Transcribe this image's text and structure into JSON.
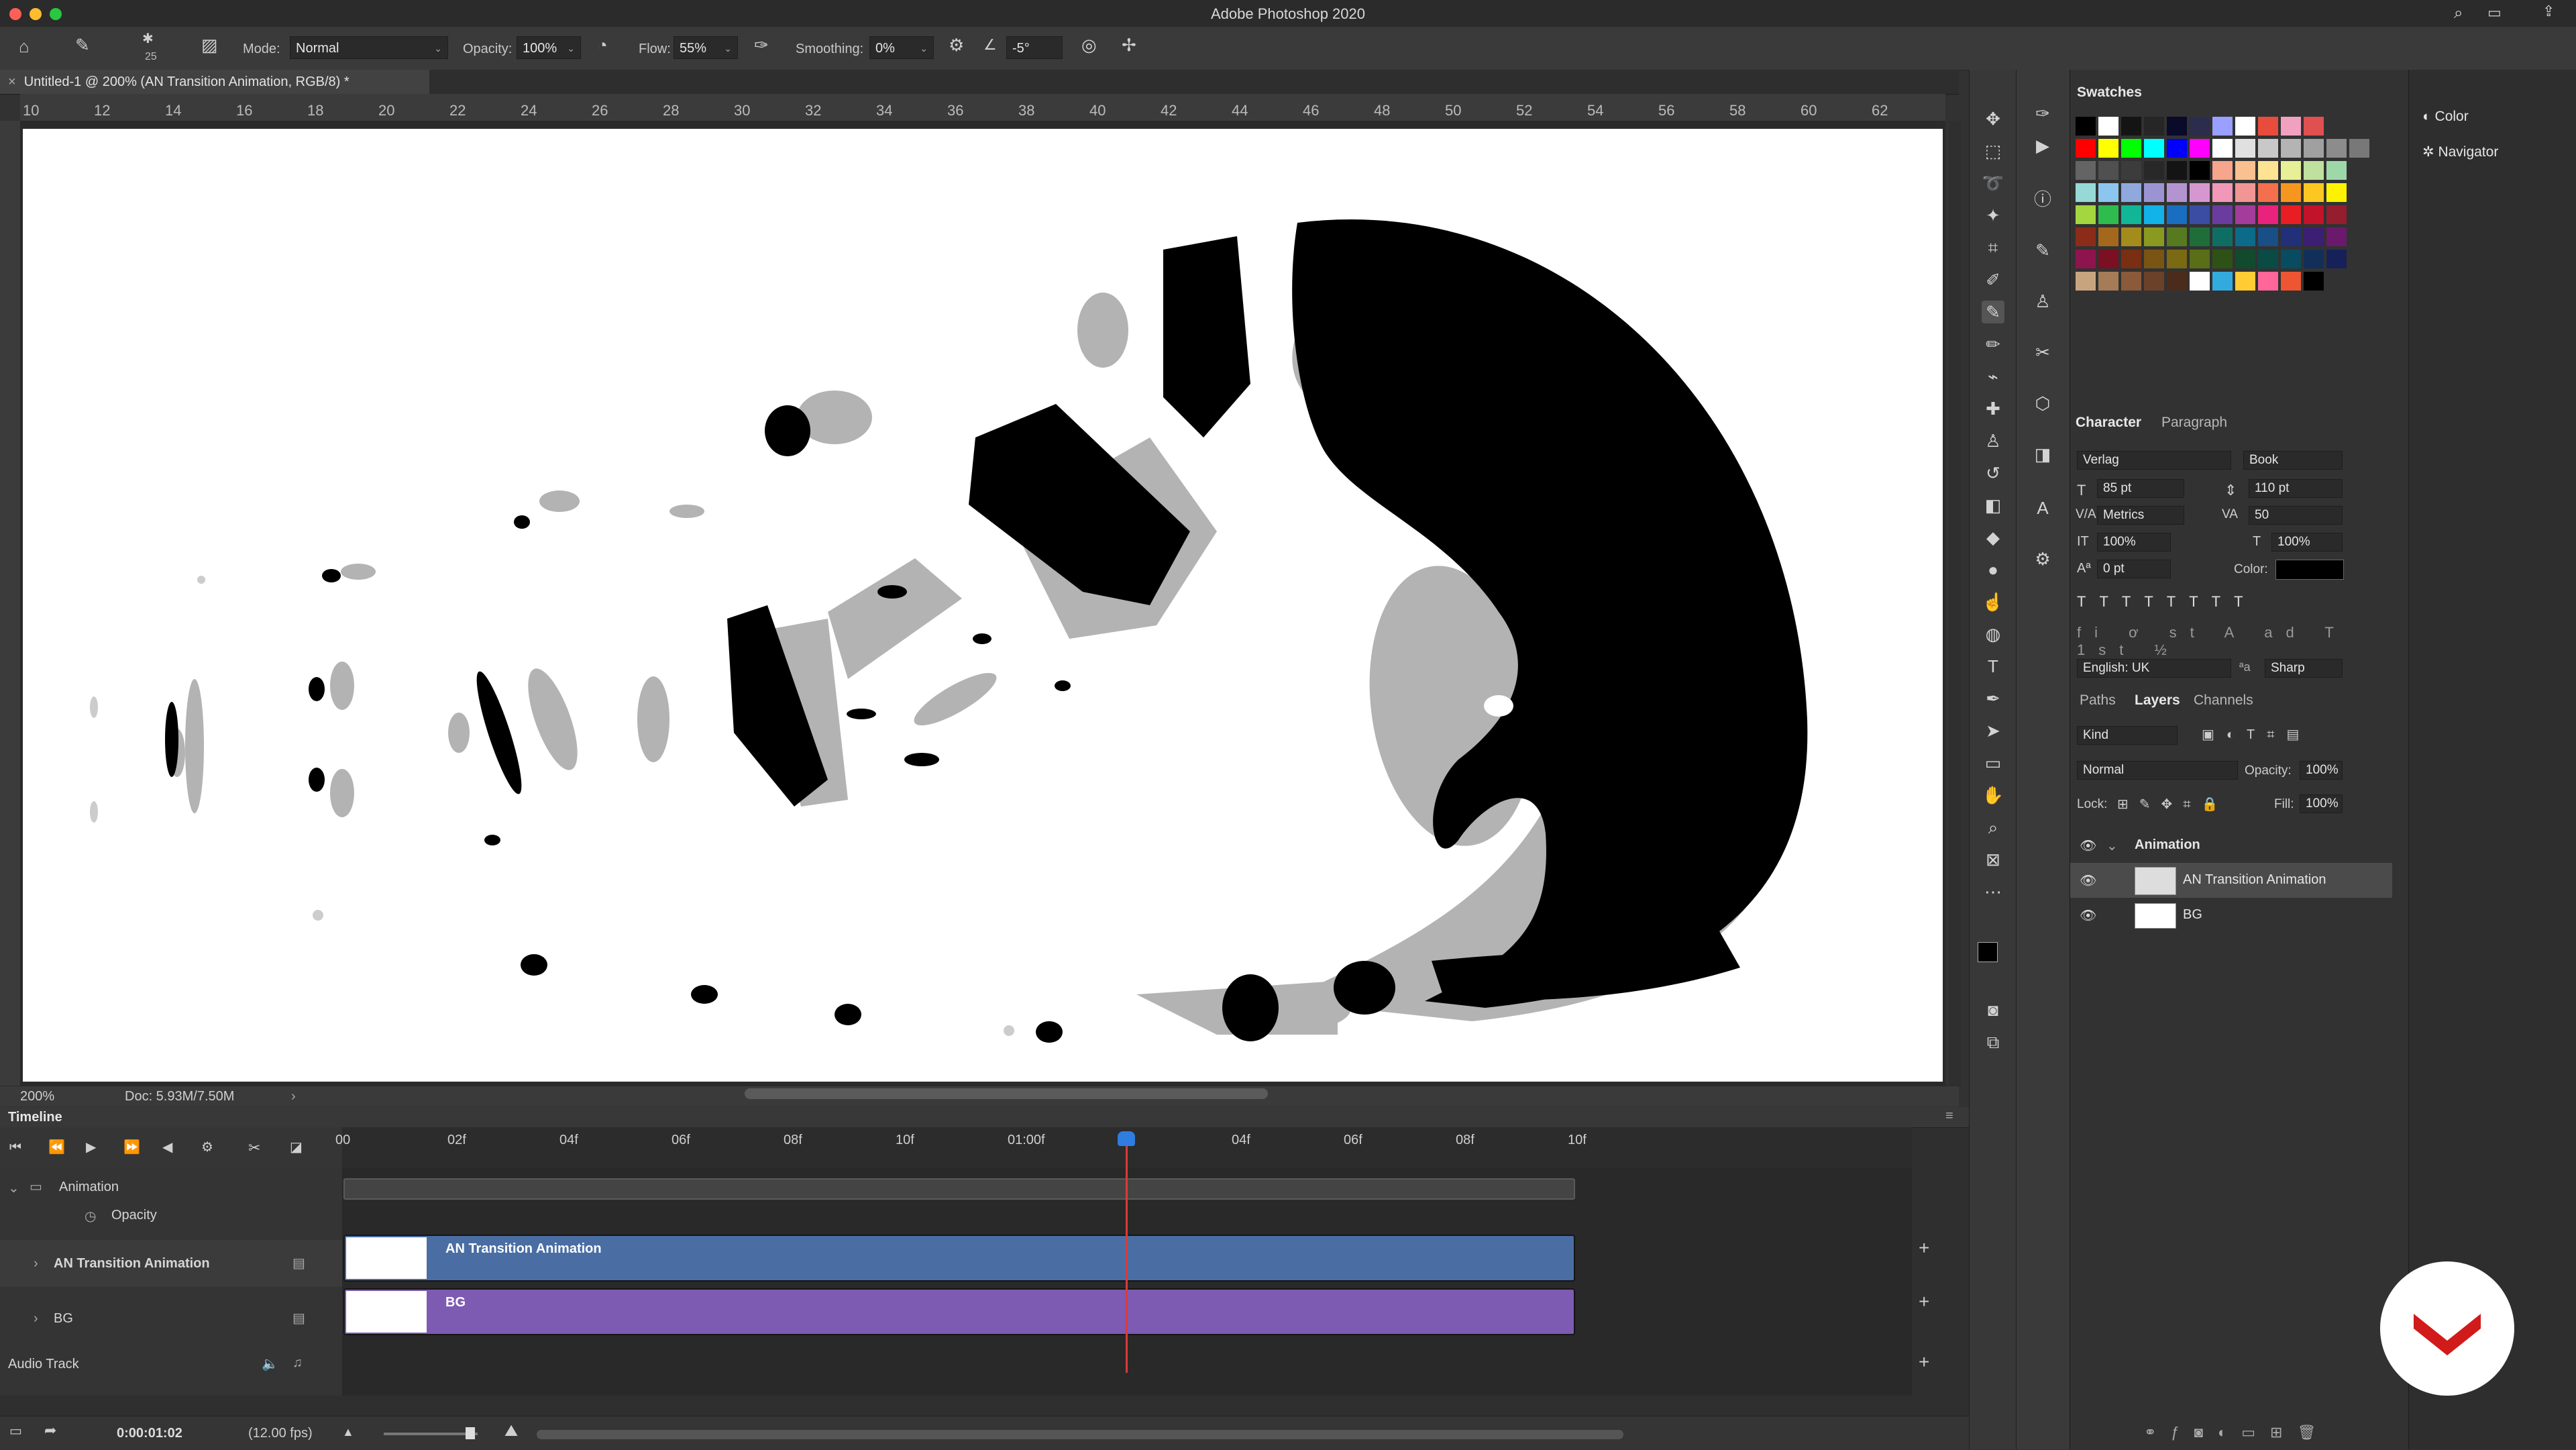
{
  "window": {
    "title": "Adobe Photoshop 2020"
  },
  "options_bar": {
    "brush_size": "25",
    "mode_label": "Mode:",
    "mode_value": "Normal",
    "opacity_label": "Opacity:",
    "opacity_value": "100%",
    "flow_label": "Flow:",
    "flow_value": "55%",
    "smoothing_label": "Smoothing:",
    "smoothing_value": "0%",
    "angle_value": "-5°"
  },
  "document": {
    "tab_title": "Untitled-1 @ 200% (AN Transition Animation, RGB/8) *"
  },
  "ruler": {
    "h_ticks": [
      "10",
      "12",
      "14",
      "16",
      "18",
      "20",
      "22",
      "24",
      "26",
      "28",
      "30",
      "32",
      "34",
      "36",
      "38",
      "40",
      "42",
      "44",
      "46",
      "48",
      "50",
      "52",
      "54",
      "56",
      "58",
      "60",
      "62"
    ]
  },
  "status": {
    "zoom": "200%",
    "doc": "Doc: 5.93M/7.50M"
  },
  "timeline": {
    "title": "Timeline",
    "frame_labels": [
      "00",
      "02f",
      "04f",
      "06f",
      "08f",
      "10f",
      "01:00f",
      "",
      "04f",
      "06f",
      "08f",
      "10f"
    ],
    "group_name": "Animation",
    "opacity_label": "Opacity",
    "layers": [
      {
        "name": "AN Transition Animation",
        "clip_name": "AN Transition Animation",
        "color": "#4a6ea3"
      },
      {
        "name": "BG",
        "clip_name": "BG",
        "color": "#7d5bb2"
      }
    ],
    "audio_label": "Audio Track",
    "timecode": "0:00:01:02",
    "fps": "(12.00 fps)"
  },
  "swatches": {
    "title": "Swatches",
    "colors": [
      [
        "#000000",
        "#ffffff",
        "#141414",
        "#262626",
        "#0a0a2a",
        "#2c2c4c",
        "#9aa0ff",
        "#ffffff",
        "#e74c3c",
        "#f2a0c0",
        "#e05050"
      ],
      [
        "#ff0000",
        "#ffff00",
        "#00ff00",
        "#00ffff",
        "#0000ff",
        "#ff00ff",
        "#ffffff",
        "#e0e0e0",
        "#c8c8c8",
        "#b4b4b4",
        "#a0a0a0",
        "#8c8c8c",
        "#787878"
      ],
      [
        "#646464",
        "#505050",
        "#3c3c3c",
        "#282828",
        "#141414",
        "#000000",
        "#f7a58c",
        "#fbc08f",
        "#fde392",
        "#e7ef97",
        "#bfe09e",
        "#9ed8a8"
      ],
      [
        "#96d9d6",
        "#8cc6ee",
        "#8fa9dd",
        "#9c94d2",
        "#b494d0",
        "#d697d0",
        "#f197b8",
        "#f29595",
        "#f36f4e",
        "#f7961f",
        "#fdc722",
        "#fff200"
      ],
      [
        "#a3d63f",
        "#2fbc4f",
        "#11b697",
        "#11b3e9",
        "#1a6ec2",
        "#3b4da3",
        "#6b3c9f",
        "#a43c9b",
        "#e9227b",
        "#e91e25",
        "#c2132a",
        "#951e2e"
      ],
      [
        "#8a2c19",
        "#a4681c",
        "#a48c1c",
        "#8a9a20",
        "#577a20",
        "#1f6e3a",
        "#0f6e63",
        "#0b6b88",
        "#194e87",
        "#22307a",
        "#3c1f72",
        "#6a196d"
      ],
      [
        "#8e144d",
        "#7a1022",
        "#7a2e12",
        "#7a5412",
        "#7a6a12",
        "#596e16",
        "#2e5216",
        "#114a2c",
        "#0b4b45",
        "#094b61",
        "#122f5a",
        "#16215a"
      ],
      [
        "#c8a47e",
        "#a57b58",
        "#8a5a3a",
        "#6b412a",
        "#4b2c1c",
        "#ffffff",
        "#33aadd",
        "#ffcc33",
        "#ff6699",
        "#ee5533",
        "#000000"
      ]
    ]
  },
  "character": {
    "tab_active": "Character",
    "tab_other": "Paragraph",
    "font_family": "Verlag",
    "font_style": "Book",
    "size": "85 pt",
    "leading": "110 pt",
    "kerning": "Metrics",
    "tracking": "50",
    "vscale": "100%",
    "hscale": "100%",
    "baseline": "0 pt",
    "color_label": "Color:",
    "language": "English: UK",
    "antialias": "Sharp"
  },
  "layers_panel": {
    "tabs": [
      "Paths",
      "Layers",
      "Channels"
    ],
    "kind": "Kind",
    "blend": "Normal",
    "opacity_label": "Opacity:",
    "opacity": "100%",
    "lock_label": "Lock:",
    "fill_label": "Fill:",
    "fill": "100%",
    "items": [
      "Animation",
      "AN Transition Animation",
      "BG"
    ]
  },
  "collapsed_panels": [
    "Color",
    "Navigator"
  ]
}
